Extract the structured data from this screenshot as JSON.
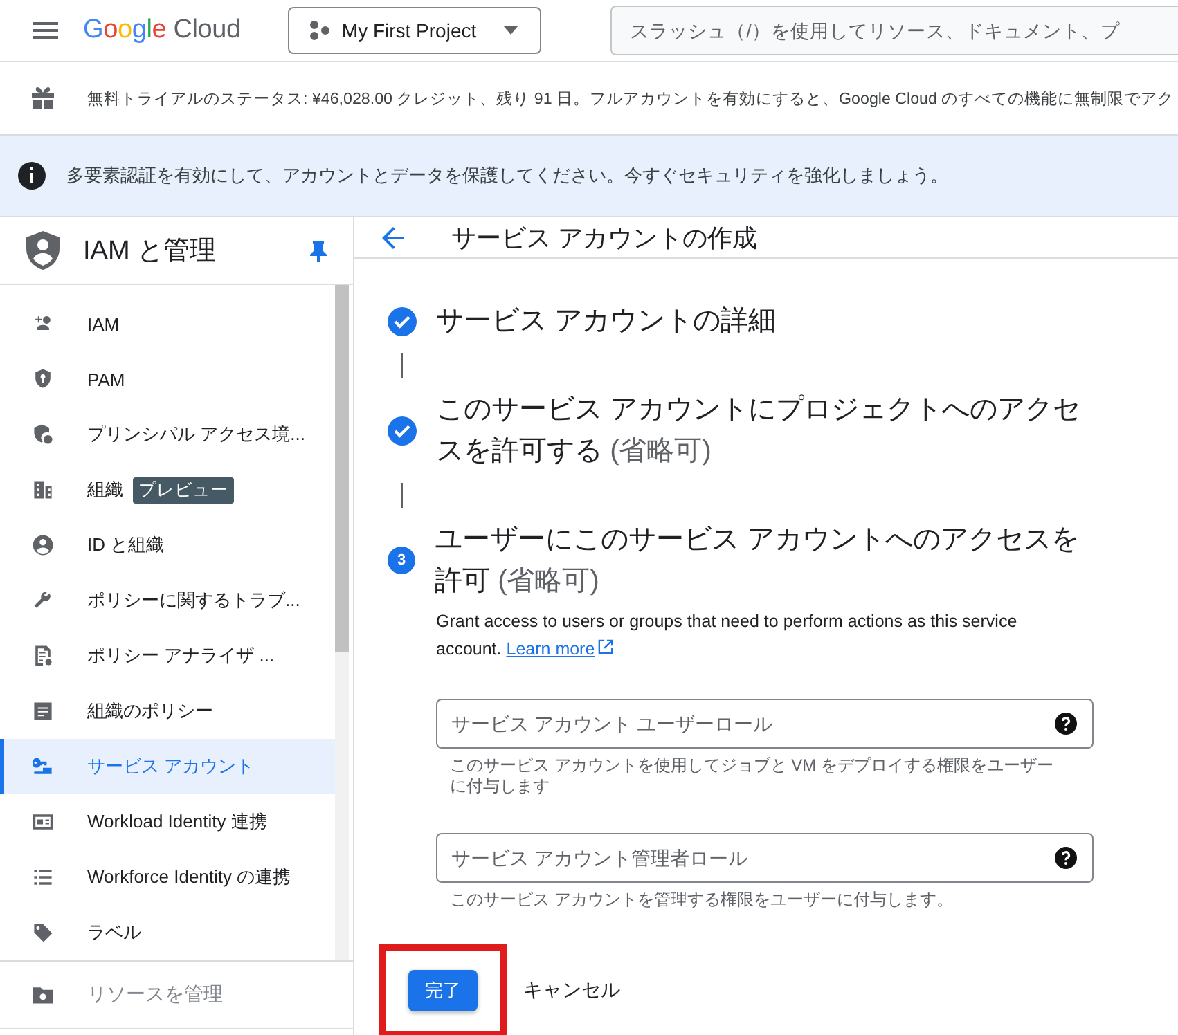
{
  "topbar": {
    "logo": "Google Cloud",
    "project": "My First Project",
    "search": {
      "placeholder": "スラッシュ（/）を使用してリソース、ドキュメント、プ"
    }
  },
  "trial_bar": {
    "text": "無料トライアルのステータス: ¥46,028.00 クレジット、残り 91 日。フルアカウントを有効にすると、Google Cloud のすべての機能に無制限でアク"
  },
  "mfa_banner": {
    "text": "多要素認証を有効にして、アカウントとデータを保護してください。今すぐセキュリティを強化しましょう。"
  },
  "sidebar": {
    "title": "IAM と管理",
    "pinned": true,
    "items": [
      {
        "label": "IAM",
        "selected": false
      },
      {
        "label": "PAM",
        "selected": false
      },
      {
        "label": "プリンシパル アクセス境...",
        "selected": false
      },
      {
        "label": "組織",
        "badge": "プレビュー",
        "selected": false
      },
      {
        "label": "ID と組織",
        "selected": false
      },
      {
        "label": "ポリシーに関するトラブ...",
        "selected": false
      },
      {
        "label": "ポリシー アナライザ ...",
        "selected": false
      },
      {
        "label": "組織のポリシー",
        "selected": false
      },
      {
        "label": "サービス アカウント",
        "selected": true
      },
      {
        "label": "Workload Identity 連携",
        "selected": false
      },
      {
        "label": "Workforce Identity の連携",
        "selected": false
      },
      {
        "label": "ラベル",
        "selected": false
      }
    ],
    "footer_item": {
      "label": "リソースを管理",
      "disabled": true
    }
  },
  "page": {
    "title": "サービス アカウントの作成",
    "steps": [
      {
        "completed": true,
        "title": "サービス アカウントの詳細"
      },
      {
        "completed": true,
        "title": "このサービス アカウントにプロジェクトへのアクセスを許可する",
        "optional": "(省略可)"
      },
      {
        "completed": false,
        "number": "3",
        "title": "ユーザーにこのサービス アカウントへのアクセスを許可",
        "optional": "(省略可)"
      }
    ],
    "description": "Grant access to users or groups that need to perform actions as this service account.",
    "learn_more": "Learn more",
    "fields": [
      {
        "placeholder": "サービス アカウント ユーザーロール",
        "hint": "このサービス アカウントを使用してジョブと VM をデプロイする権限をユーザーに付与します"
      },
      {
        "placeholder": "サービス アカウント管理者ロール",
        "hint": "このサービス アカウントを管理する権限をユーザーに付与します。"
      }
    ],
    "done_button": {
      "label": "完了",
      "highlighted": true
    },
    "cancel_button": {
      "label": "キャンセル"
    }
  }
}
